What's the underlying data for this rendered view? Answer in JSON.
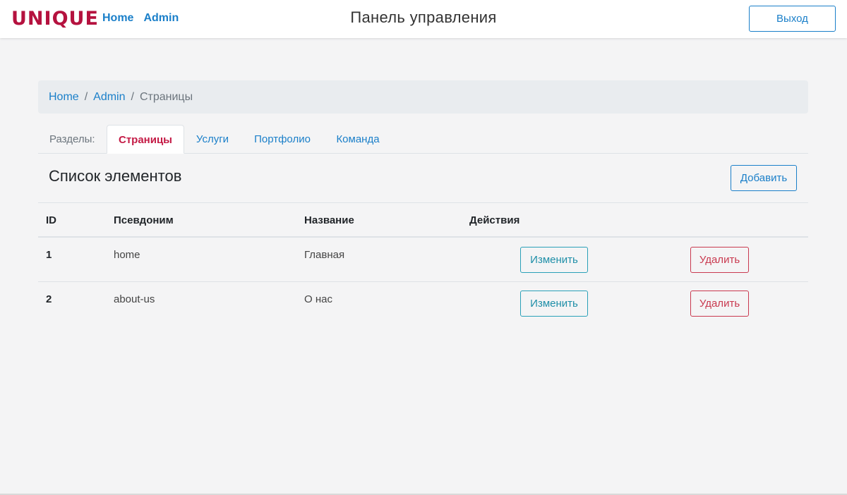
{
  "navbar": {
    "logo": "UNIQUE",
    "links": [
      "Home",
      "Admin"
    ],
    "title": "Панель управления",
    "logout_label": "Выход"
  },
  "breadcrumb": {
    "items": [
      "Home",
      "Admin"
    ],
    "active": "Страницы"
  },
  "tabs": {
    "label": "Разделы:",
    "items": [
      "Страницы",
      "Услуги",
      "Портфолио",
      "Команда"
    ],
    "active_index": 0
  },
  "list": {
    "title": "Список элементов",
    "add_label": "Добавить"
  },
  "table": {
    "headers": [
      "ID",
      "Псевдоним",
      "Название",
      "Действия"
    ],
    "rows": [
      {
        "id": "1",
        "alias": "home",
        "name": "Главная",
        "edit_label": "Изменить",
        "delete_label": "Удалить"
      },
      {
        "id": "2",
        "alias": "about-us",
        "name": "О нас",
        "edit_label": "Изменить",
        "delete_label": "Удалить"
      }
    ]
  },
  "colors": {
    "brand": "#b5123f",
    "link": "#1a7fc9",
    "active_tab": "#c41a45",
    "edit": "#2aa0b8",
    "delete": "#c9394f"
  }
}
